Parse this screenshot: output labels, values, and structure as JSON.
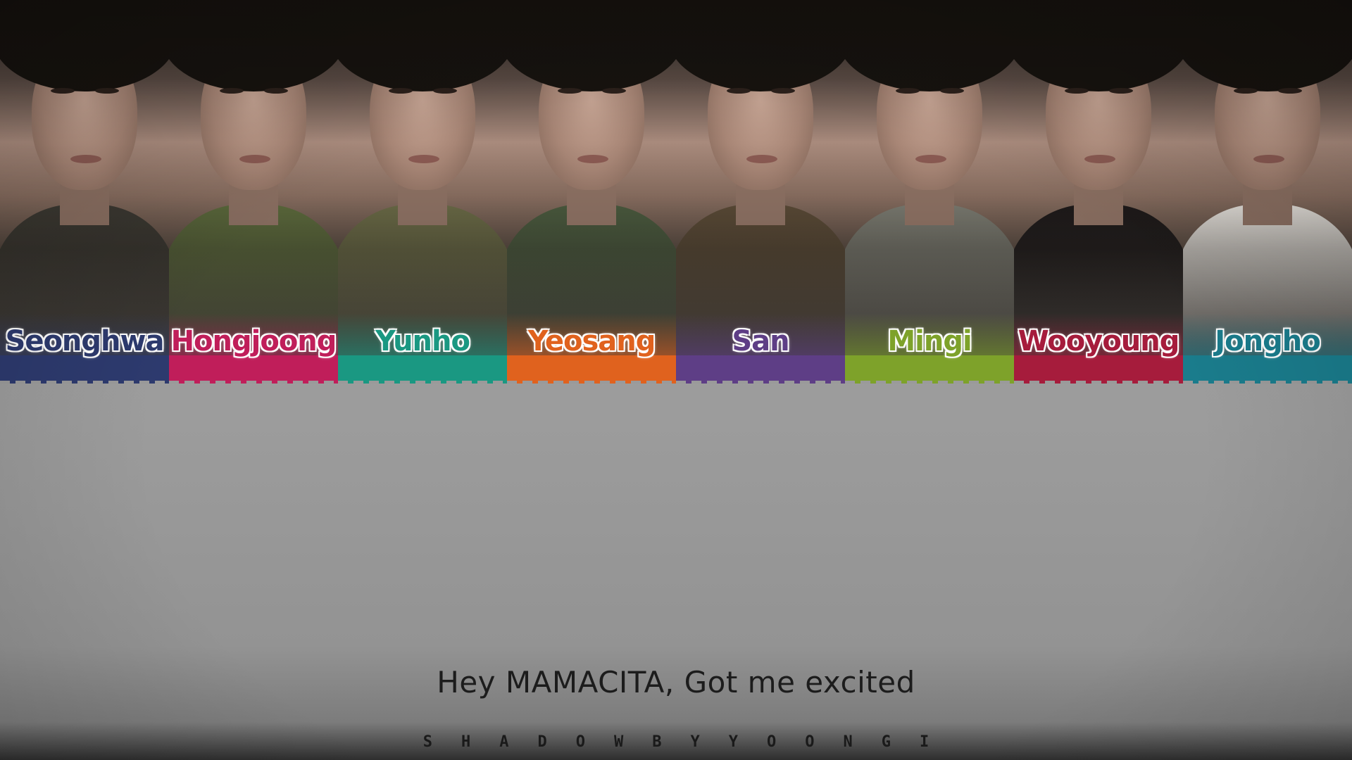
{
  "members": [
    {
      "name": "Seonghwa",
      "color": "#2d3a6e",
      "outfit": "#3d3a33"
    },
    {
      "name": "Hongjoong",
      "color": "#c01e5a",
      "outfit": "#5c6a3c"
    },
    {
      "name": "Yunho",
      "color": "#1a9882",
      "outfit": "#6a6a46"
    },
    {
      "name": "Yeosang",
      "color": "#e0621e",
      "outfit": "#4a5a3e"
    },
    {
      "name": "San",
      "color": "#5e3e86",
      "outfit": "#5a4a36"
    },
    {
      "name": "Mingi",
      "color": "#7ea22a",
      "outfit": "#7a7a70"
    },
    {
      "name": "Wooyoung",
      "color": "#a61c3c",
      "outfit": "#1e1a1a"
    },
    {
      "name": "Jongho",
      "color": "#1a7c8c",
      "outfit": "#e8e4de"
    }
  ],
  "lyric": "Hey MAMACITA, Got me excited",
  "credit": "SHADOWBYYOONGI"
}
